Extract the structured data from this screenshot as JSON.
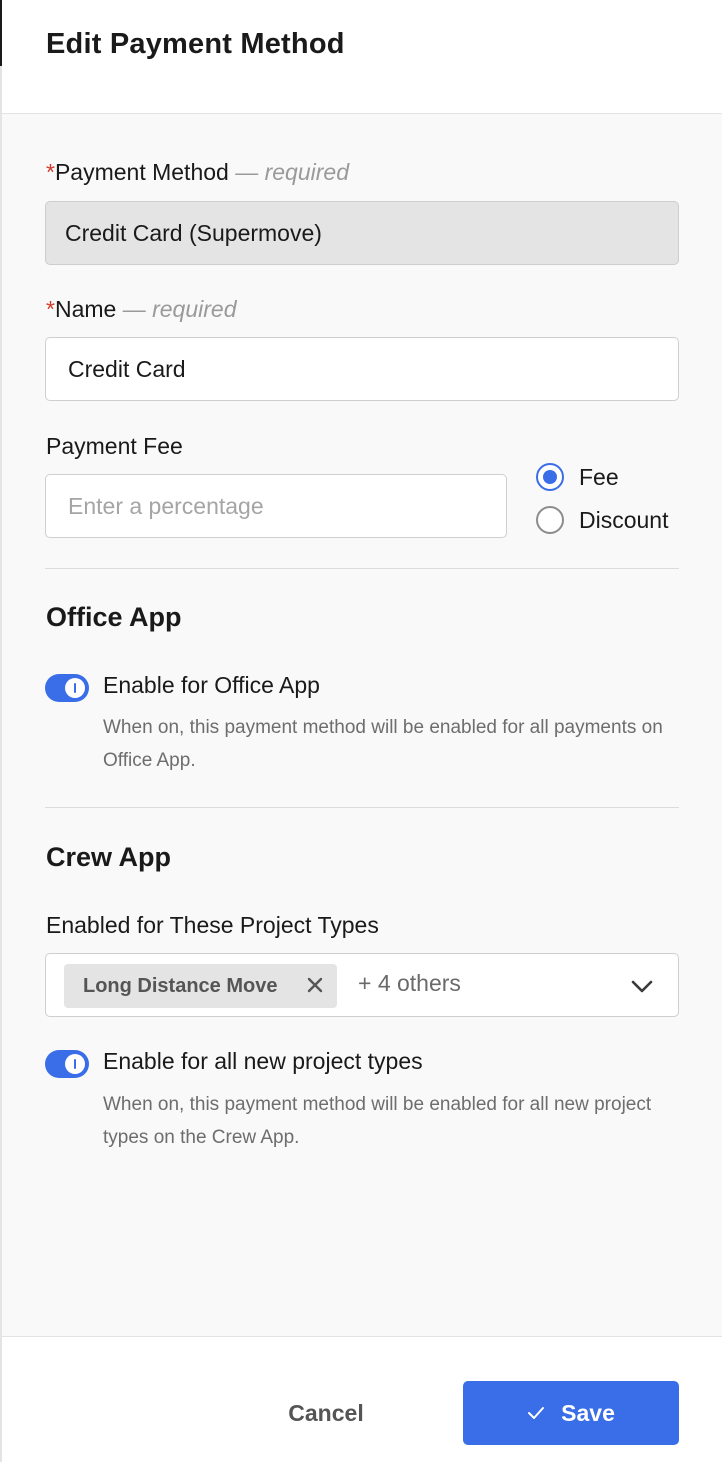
{
  "header": {
    "title": "Edit Payment Method"
  },
  "payment_method": {
    "label": "Payment Method",
    "required_marker": "*",
    "required_text": "— required",
    "value": "Credit Card (Supermove)"
  },
  "name": {
    "label": "Name",
    "required_marker": "*",
    "required_text": "— required",
    "value": "Credit Card"
  },
  "payment_fee": {
    "label": "Payment Fee",
    "placeholder": "Enter a percentage",
    "value": "",
    "options": [
      {
        "label": "Fee",
        "checked": true
      },
      {
        "label": "Discount",
        "checked": false
      }
    ]
  },
  "office_app": {
    "title": "Office App",
    "toggle_label": "Enable for Office App",
    "toggle_on": true,
    "helper": "When on, this payment method will be enabled for all payments on Office App."
  },
  "crew_app": {
    "title": "Crew App",
    "project_types_label": "Enabled for These Project Types",
    "selected_chip": "Long Distance Move",
    "others_text": "+ 4 others",
    "toggle_label": "Enable for all new project types",
    "toggle_on": true,
    "helper": "When on, this payment method will be enabled for all new project types on the Crew App."
  },
  "footer": {
    "cancel_label": "Cancel",
    "save_label": "Save"
  },
  "colors": {
    "accent": "#3a6ee8",
    "required_star": "#d33a2c"
  },
  "icons": {
    "chip_remove": "close-icon",
    "dropdown": "chevron-down-icon",
    "save": "checkmark-icon"
  }
}
